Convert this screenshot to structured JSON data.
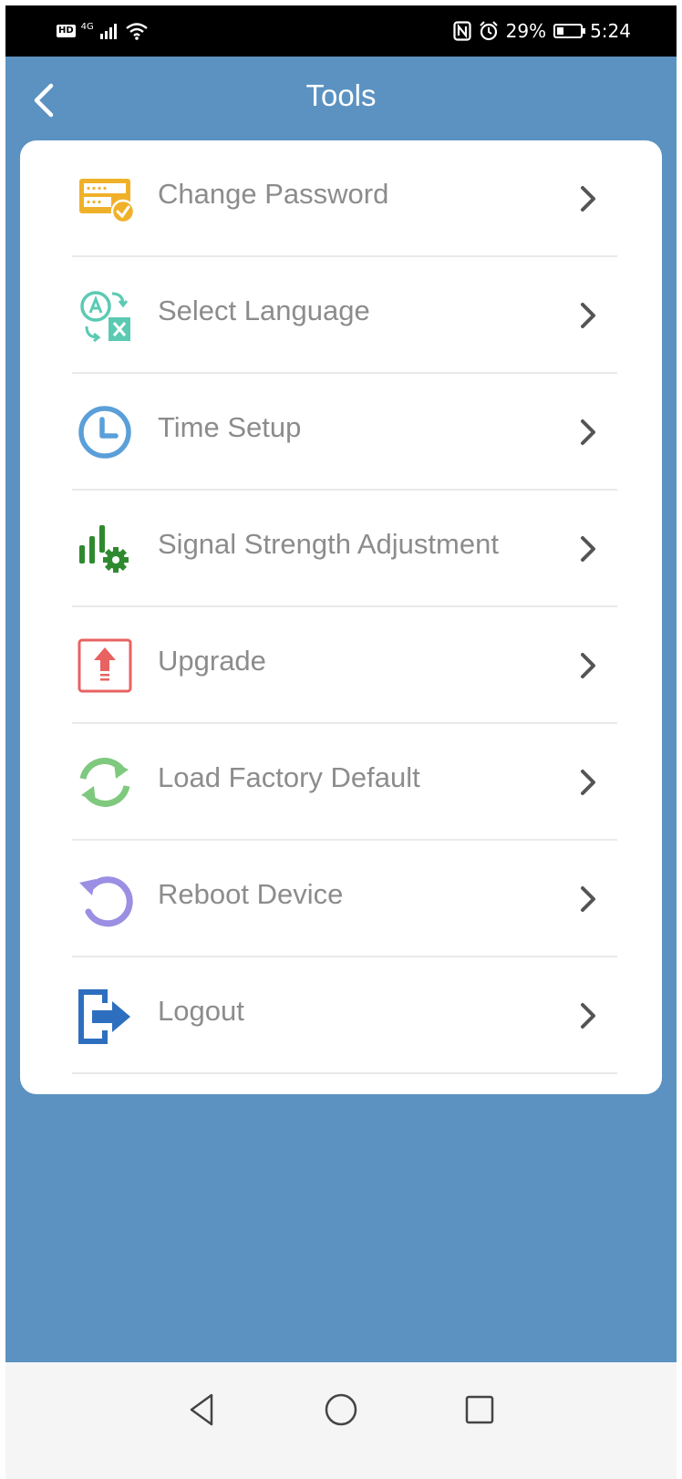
{
  "status_bar": {
    "hd": "HD",
    "network": "4G",
    "battery_text": "29%",
    "battery_level": 0.29,
    "time": "5:24"
  },
  "header": {
    "title": "Tools",
    "back_icon": "chevron-left-icon"
  },
  "menu": {
    "items": [
      {
        "label": "Change Password",
        "icon": "password-icon",
        "color": "#f0b12a"
      },
      {
        "label": "Select Language",
        "icon": "translate-icon",
        "color": "#5bcab3"
      },
      {
        "label": "Time Setup",
        "icon": "clock-icon",
        "color": "#5b9fd9"
      },
      {
        "label": "Signal Strength Adjustment",
        "icon": "signal-settings-icon",
        "color": "#2f8a2f"
      },
      {
        "label": "Upgrade",
        "icon": "upgrade-icon",
        "color": "#e86262"
      },
      {
        "label": "Load Factory Default",
        "icon": "refresh-icon",
        "color": "#7fc97f"
      },
      {
        "label": "Reboot Device",
        "icon": "reboot-icon",
        "color": "#9a8fe3"
      },
      {
        "label": "Logout",
        "icon": "logout-icon",
        "color": "#2d6fbe"
      }
    ]
  },
  "nav_bar": {
    "back": "triangle-back-icon",
    "home": "circle-home-icon",
    "recents": "square-recents-icon"
  },
  "colors": {
    "background": "#5b92c1",
    "card": "#ffffff",
    "label_text": "#8c8c8c",
    "chevron": "#555555"
  }
}
